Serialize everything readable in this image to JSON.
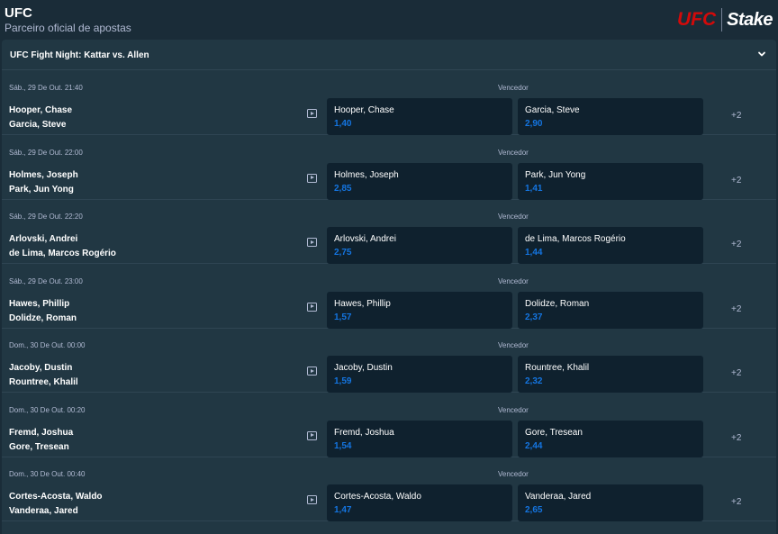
{
  "header": {
    "title": "UFC",
    "subtitle": "Parceiro oficial de apostas",
    "ufc_logo": "UFC",
    "stake_logo": "Stake"
  },
  "event": {
    "title": "UFC Fight Night: Kattar vs. Allen",
    "toggle_icon": "chevron-down-icon"
  },
  "matches": [
    {
      "date": "Sáb., 29 De Out. 21:40",
      "market": "Vencedor",
      "fighter1": "Hooper, Chase",
      "fighter2": "Garcia, Steve",
      "odds1": "1,40",
      "odds2": "2,90",
      "more": "+2"
    },
    {
      "date": "Sáb., 29 De Out. 22:00",
      "market": "Vencedor",
      "fighter1": "Holmes, Joseph",
      "fighter2": "Park, Jun Yong",
      "odds1": "2,85",
      "odds2": "1,41",
      "more": "+2"
    },
    {
      "date": "Sáb., 29 De Out. 22:20",
      "market": "Vencedor",
      "fighter1": "Arlovski, Andrei",
      "fighter2": "de Lima, Marcos Rogério",
      "odds1": "2,75",
      "odds2": "1,44",
      "more": "+2"
    },
    {
      "date": "Sáb., 29 De Out. 23:00",
      "market": "Vencedor",
      "fighter1": "Hawes, Phillip",
      "fighter2": "Dolidze, Roman",
      "odds1": "1,57",
      "odds2": "2,37",
      "more": "+2"
    },
    {
      "date": "Dom., 30 De Out. 00:00",
      "market": "Vencedor",
      "fighter1": "Jacoby, Dustin",
      "fighter2": "Rountree, Khalil",
      "odds1": "1,59",
      "odds2": "2,32",
      "more": "+2"
    },
    {
      "date": "Dom., 30 De Out. 00:20",
      "market": "Vencedor",
      "fighter1": "Fremd, Joshua",
      "fighter2": "Gore, Tresean",
      "odds1": "1,54",
      "odds2": "2,44",
      "more": "+2"
    },
    {
      "date": "Dom., 30 De Out. 00:40",
      "market": "Vencedor",
      "fighter1": "Cortes-Acosta, Waldo",
      "fighter2": "Vanderaa, Jared",
      "odds1": "1,47",
      "odds2": "2,65",
      "more": "+2"
    }
  ],
  "colors": {
    "background": "#1a2c38",
    "panel": "#213743",
    "odds_box": "#0f212e",
    "odds_text": "#1475e1",
    "muted_text": "#b1bad3",
    "ufc_red": "#d20a0a"
  }
}
